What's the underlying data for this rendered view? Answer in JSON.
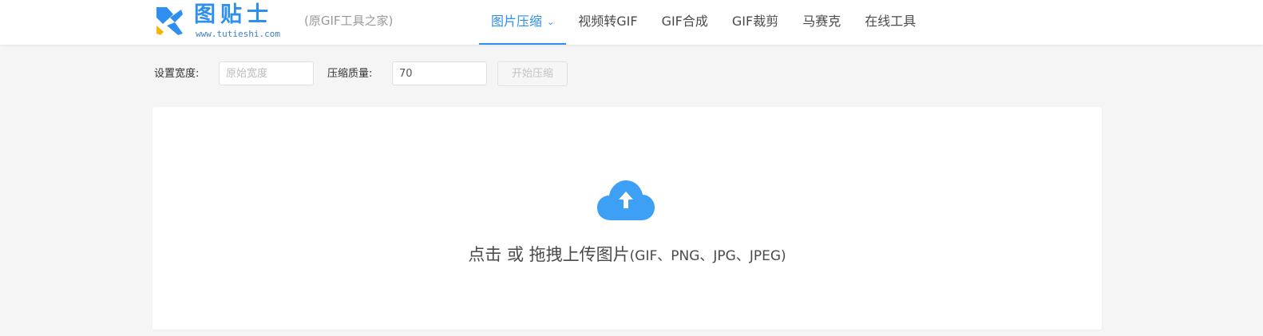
{
  "brand": {
    "title": "图贴士",
    "url": "www.tutieshi.com",
    "subtitle": "(原GIF工具之家)"
  },
  "nav": {
    "items": [
      {
        "label": "图片压缩",
        "active": true,
        "has_dropdown": true
      },
      {
        "label": "视频转GIF"
      },
      {
        "label": "GIF合成"
      },
      {
        "label": "GIF裁剪"
      },
      {
        "label": "马赛克"
      },
      {
        "label": "在线工具"
      }
    ]
  },
  "toolbar": {
    "width_label": "设置宽度:",
    "width_placeholder": "原始宽度",
    "quality_label": "压缩质量:",
    "quality_value": "70",
    "start_button": "开始压缩"
  },
  "upload": {
    "prompt": "点击 或 拖拽上传图片",
    "formats": "(GIF、PNG、JPG、JPEG)"
  },
  "colors": {
    "accent": "#2f8ff0",
    "cloud": "#3ea0f5"
  },
  "icons": {
    "logo": "tutieshi-logo-mark",
    "dropdown": "chevron-down-icon",
    "upload": "cloud-upload-icon"
  }
}
